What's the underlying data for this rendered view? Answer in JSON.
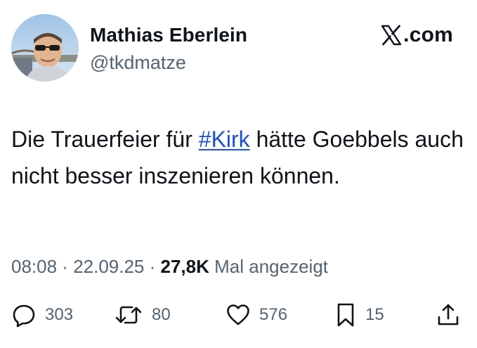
{
  "author": {
    "display_name": "Mathias Eberlein",
    "handle": "@tkdmatze"
  },
  "brand": {
    "icon": "x-logo-icon",
    "text": ".com"
  },
  "tweet": {
    "text_before": "Die Trauerfeier für ",
    "hashtag": "#Kirk",
    "text_after": " hätte Goebbels auch nicht besser inszenieren können."
  },
  "meta": {
    "time": "08:08",
    "separator_1": " · ",
    "date": "22.09.25",
    "separator_2": " · ",
    "views": "27,8K",
    "views_label": " Mal angezeigt"
  },
  "actions": {
    "reply": {
      "icon": "reply-icon",
      "count": "303"
    },
    "repost": {
      "icon": "repost-icon",
      "count": "80"
    },
    "like": {
      "icon": "heart-icon",
      "count": "576"
    },
    "bookmark": {
      "icon": "bookmark-icon",
      "count": "15"
    },
    "share": {
      "icon": "share-icon"
    }
  },
  "colors": {
    "text": "#0f1419",
    "secondary": "#536471",
    "link": "#1d4ed8",
    "background": "#ffffff"
  }
}
